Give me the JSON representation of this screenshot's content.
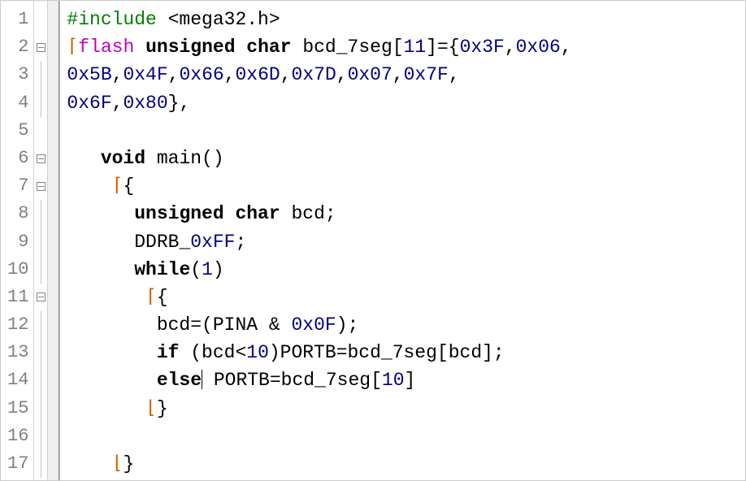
{
  "lines": {
    "l1_pre": "#include",
    "l1_inc": " <mega32.h>",
    "l2_flash": "flash",
    "l2_kw": " unsigned char ",
    "l2_id": "bcd_7seg",
    "l2_op1": "[",
    "l2_num_sz": "11",
    "l2_op2": "]={",
    "l2_v0": "0x3F",
    "l2_c0": ",",
    "l2_v1": "0x06",
    "l2_c1": ",",
    "l3_v2": "0x5B",
    "l3_c2": ",",
    "l3_v3": "0x4F",
    "l3_c3": ",",
    "l3_v4": "0x66",
    "l3_c4": ",",
    "l3_v5": "0x6D",
    "l3_c5": ",",
    "l3_v6": "0x7D",
    "l3_c6": ",",
    "l3_v7": "0x07",
    "l3_c7": ",",
    "l3_v8": "0x7F",
    "l3_c8": ",",
    "l4_v9": "0x6F",
    "l4_c9": ",",
    "l4_v10": "0x80",
    "l4_end": "},",
    "l6_kw": "void",
    "l6_id": " main()",
    "l7_brace": "{",
    "l8_kw": "unsigned char ",
    "l8_id": "bcd;",
    "l9_id1": "DDRB_",
    "l9_num": "0xFF",
    "l9_sc": ";",
    "l10_kw": "while",
    "l10_p": "(",
    "l10_num": "1",
    "l10_p2": ")",
    "l11_brace": "{",
    "l12_id": "bcd=(PINA & ",
    "l12_num": "0x0F",
    "l12_end": ");",
    "l13_kw": "if",
    "l13_p": " (bcd<",
    "l13_num": "10",
    "l13_p2": ")PORTB=bcd_7seg[bcd];",
    "l14_kw": "else",
    "l14_p": " PORTB=bcd_7seg[",
    "l14_num": "10",
    "l14_p2": "]",
    "l15_brace": "}",
    "l17_brace": "}"
  },
  "linenums": [
    "1",
    "2",
    "3",
    "4",
    "5",
    "6",
    "7",
    "8",
    "9",
    "10",
    "11",
    "12",
    "13",
    "14",
    "15",
    "16",
    "17"
  ]
}
